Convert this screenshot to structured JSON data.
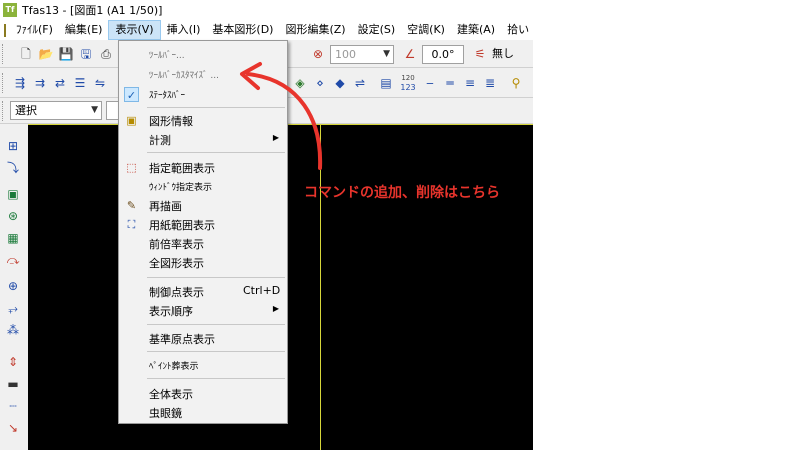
{
  "window": {
    "title": "Tfas13 - [図面1 (A1 1/50)]"
  },
  "menubar": {
    "items": [
      {
        "label": "ﾌｧｲﾙ(F)"
      },
      {
        "label": "編集(E)"
      },
      {
        "label": "表示(V)",
        "active": true
      },
      {
        "label": "挿入(I)"
      },
      {
        "label": "基本図形(D)"
      },
      {
        "label": "図形編集(Z)"
      },
      {
        "label": "設定(S)"
      },
      {
        "label": "空調(K)"
      },
      {
        "label": "建築(A)"
      },
      {
        "label": "拾い"
      }
    ]
  },
  "toolbar": {
    "zoom_value": "100",
    "angle_value": "0.0°",
    "line_style": "無し",
    "mode_select": "選択",
    "label_123": "123",
    "label_120": "120"
  },
  "view_menu": {
    "items": [
      {
        "label": "ﾂｰﾙﾊﾞｰ...",
        "disabled": true
      },
      {
        "label": "ﾂｰﾙﾊﾞｰｶｽﾀﾏｲｽﾞ ...",
        "disabled": true
      },
      {
        "label": "ｽﾃｰﾀｽﾊﾞｰ",
        "checked": true
      },
      {
        "label": "図形情報"
      },
      {
        "label": "計測",
        "submenu": true
      },
      {
        "label": "指定範囲表示"
      },
      {
        "label": "ｳｨﾝﾄﾞｳ指定表示"
      },
      {
        "label": "再描画"
      },
      {
        "label": "用紙範囲表示"
      },
      {
        "label": "前倍率表示"
      },
      {
        "label": "全図形表示"
      },
      {
        "label": "制御点表示",
        "shortcut": "Ctrl+D"
      },
      {
        "label": "表示順序",
        "submenu": true
      },
      {
        "label": "基準原点表示"
      },
      {
        "label": "ﾍﾟｲﾝﾄ葬表示"
      },
      {
        "label": "全体表示"
      },
      {
        "label": "虫眼鏡"
      }
    ]
  },
  "annotation": {
    "text": "コマンドの追加、削除はこちら",
    "color": "#e8342c"
  }
}
